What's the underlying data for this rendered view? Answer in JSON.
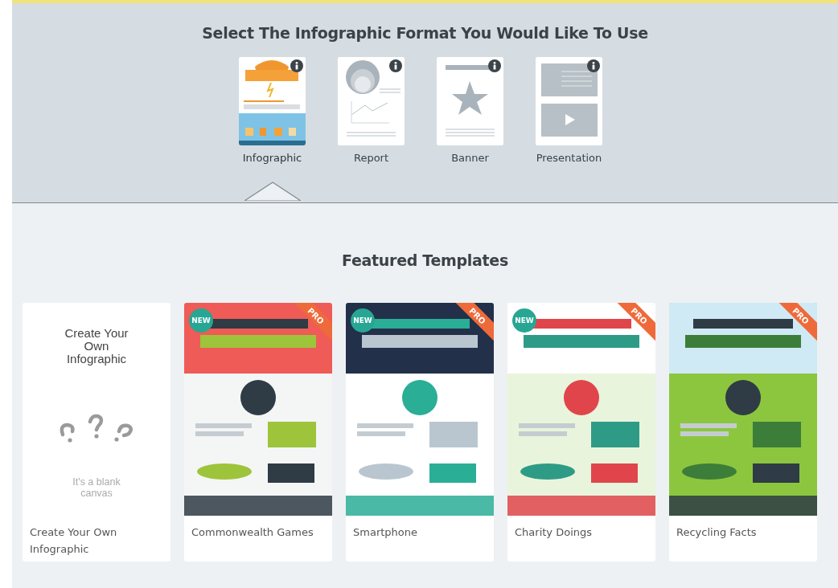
{
  "format_section": {
    "title": "Select The Infographic Format You Would Like To Use",
    "formats": [
      {
        "kind": "infographic",
        "label": "Infographic",
        "selected": true
      },
      {
        "kind": "report",
        "label": "Report",
        "selected": false
      },
      {
        "kind": "banner",
        "label": "Banner",
        "selected": false
      },
      {
        "kind": "presentation",
        "label": "Presentation",
        "selected": false
      }
    ]
  },
  "featured": {
    "title": "Featured Templates",
    "templates": [
      {
        "kind": "blank",
        "heading": "Create Your Own Infographic",
        "subtext": "It's a blank canvas",
        "caption": "Create Your Own Infographic"
      },
      {
        "kind": "template",
        "caption": "Commonwealth Games",
        "new_badge": "NEW",
        "pro_badge": "PRO"
      },
      {
        "kind": "template",
        "caption": "Smartphone",
        "new_badge": "NEW",
        "pro_badge": "PRO"
      },
      {
        "kind": "template",
        "caption": "Charity Doings",
        "new_badge": "NEW",
        "pro_badge": "PRO"
      },
      {
        "kind": "template",
        "caption": "Recycling Facts",
        "pro_badge": "PRO"
      }
    ]
  }
}
